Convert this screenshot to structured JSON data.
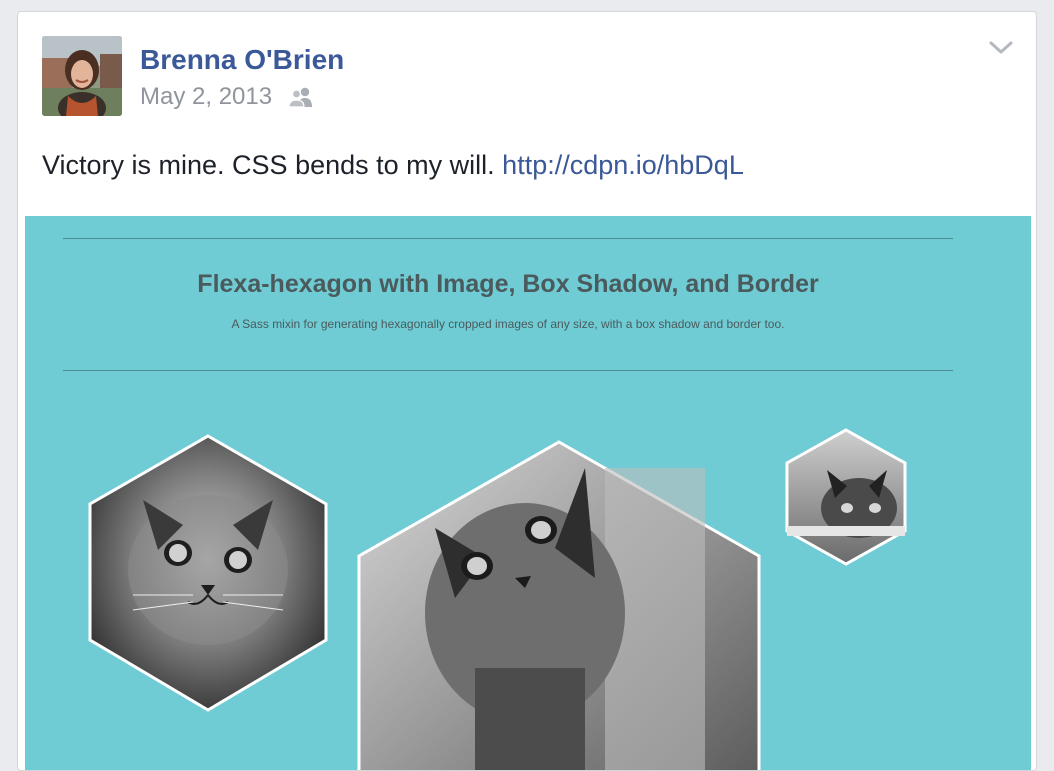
{
  "post": {
    "author": "Brenna O'Brien",
    "date": "May 2, 2013",
    "privacy_icon": "friends-icon",
    "options_icon": "chevron-down-icon",
    "text": "Victory is mine. CSS bends to my will.",
    "link": "http://cdpn.io/hbDqL"
  },
  "preview": {
    "title": "Flexa-hexagon with Image, Box Shadow, and Border",
    "subtitle": "A Sass mixin for generating hexagonally cropped images of any size, with a box shadow and border too.",
    "background_color": "#70ccd4",
    "images": [
      "kitten-photo-left",
      "kitten-photo-center",
      "kitten-photo-right"
    ]
  },
  "colors": {
    "link_blue": "#3b5998",
    "meta_gray": "#90949c",
    "text_dark": "#1d2129"
  }
}
